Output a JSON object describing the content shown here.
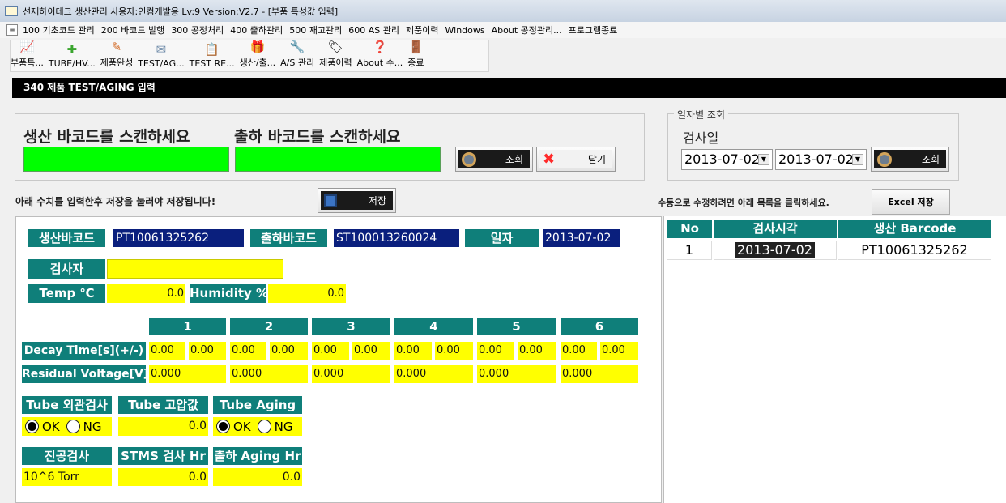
{
  "title": "선재하이테크 생산관리 사용자:인컴개발용 Lv:9 Version:V2.7 - [부품 특성값 입력]",
  "menu": [
    "100 기초코드 관리",
    "200 바코드 발행",
    "300 공정처리",
    "400 출하관리",
    "500 재고관리",
    "600 AS 관리",
    "제품이력",
    "Windows",
    "About 공정관리...",
    "프로그램종료"
  ],
  "toolbar": [
    {
      "label": "부품특...",
      "icon": "chart-icon",
      "glyph": "📈"
    },
    {
      "label": "TUBE/HV...",
      "icon": "plus-icon",
      "glyph": "✚"
    },
    {
      "label": "제품완성",
      "icon": "pencil-icon",
      "glyph": "✎"
    },
    {
      "label": "TEST/AG...",
      "icon": "mail-icon",
      "glyph": "✉"
    },
    {
      "label": "TEST RE...",
      "icon": "clipboard-icon",
      "glyph": "📋"
    },
    {
      "label": "생산/출...",
      "icon": "gift-icon",
      "glyph": "🎁"
    },
    {
      "label": "A/S 관리",
      "icon": "wrench-icon",
      "glyph": "🔧"
    },
    {
      "label": "제품이력",
      "icon": "tag-icon",
      "glyph": "🏷"
    },
    {
      "label": "About 수...",
      "icon": "help-icon",
      "glyph": "❓"
    },
    {
      "label": "종료",
      "icon": "exit-door-icon",
      "glyph": "🚪"
    }
  ],
  "section_title": "340 제품 TEST/AGING 입력",
  "scan": {
    "prod_label": "생산 바코드를 스캔하세요",
    "ship_label": "출하 바코드를 스캔하세요",
    "prod_value": "",
    "ship_value": "",
    "search": "조회",
    "close": "닫기"
  },
  "date_filter": {
    "legend": "일자별 조회",
    "label": "검사일",
    "from": "2013-07-02",
    "to": "2013-07-02",
    "search": "조회"
  },
  "save_hint": "아래 수치를 입력한후 저장을 눌러야 저장됩니다!",
  "save_button": "저장",
  "edit_hint": "수동으로 수정하려면 아래 목록을 클릭하세요.",
  "excel_button": "Excel 저장",
  "form": {
    "prod_barcode_label": "생산바코드",
    "prod_barcode": "PT10061325262",
    "ship_barcode_label": "출하바코드",
    "ship_barcode": "ST100013260024",
    "date_label": "일자",
    "date": "2013-07-02",
    "inspector_label": "검사자",
    "inspector": "",
    "temp_label": "Temp ℃",
    "temp": "0.0",
    "humidity_label": "Humidity %",
    "humidity": "0.0",
    "columns": [
      "1",
      "2",
      "3",
      "4",
      "5",
      "6"
    ],
    "decay_label": "Decay Time[s](+/-)",
    "decay": [
      [
        "0.00",
        "0.00"
      ],
      [
        "0.00",
        "0.00"
      ],
      [
        "0.00",
        "0.00"
      ],
      [
        "0.00",
        "0.00"
      ],
      [
        "0.00",
        "0.00"
      ],
      [
        "0.00",
        "0.00"
      ]
    ],
    "residual_label": "Residual Voltage[V]",
    "residual": [
      "0.000",
      "0.000",
      "0.000",
      "0.000",
      "0.000",
      "0.000"
    ],
    "tube_visual_label": "Tube 외관검사",
    "tube_hv_label": "Tube 고압값",
    "tube_aging_label": "Tube Aging",
    "ok": "OK",
    "ng": "NG",
    "tube_hv": "0.0",
    "vacuum_label": "진공검사",
    "stms_label": "STMS 검사 Hr",
    "ship_aging_label": "출하 Aging Hr",
    "vacuum": "10^6 Torr",
    "stms": "0.0",
    "ship_aging": "0.0"
  },
  "list": {
    "headers": [
      "No",
      "검사시각",
      "생산 Barcode"
    ],
    "rows": [
      [
        "1",
        "2013-07-02",
        "PT10061325262"
      ]
    ]
  }
}
